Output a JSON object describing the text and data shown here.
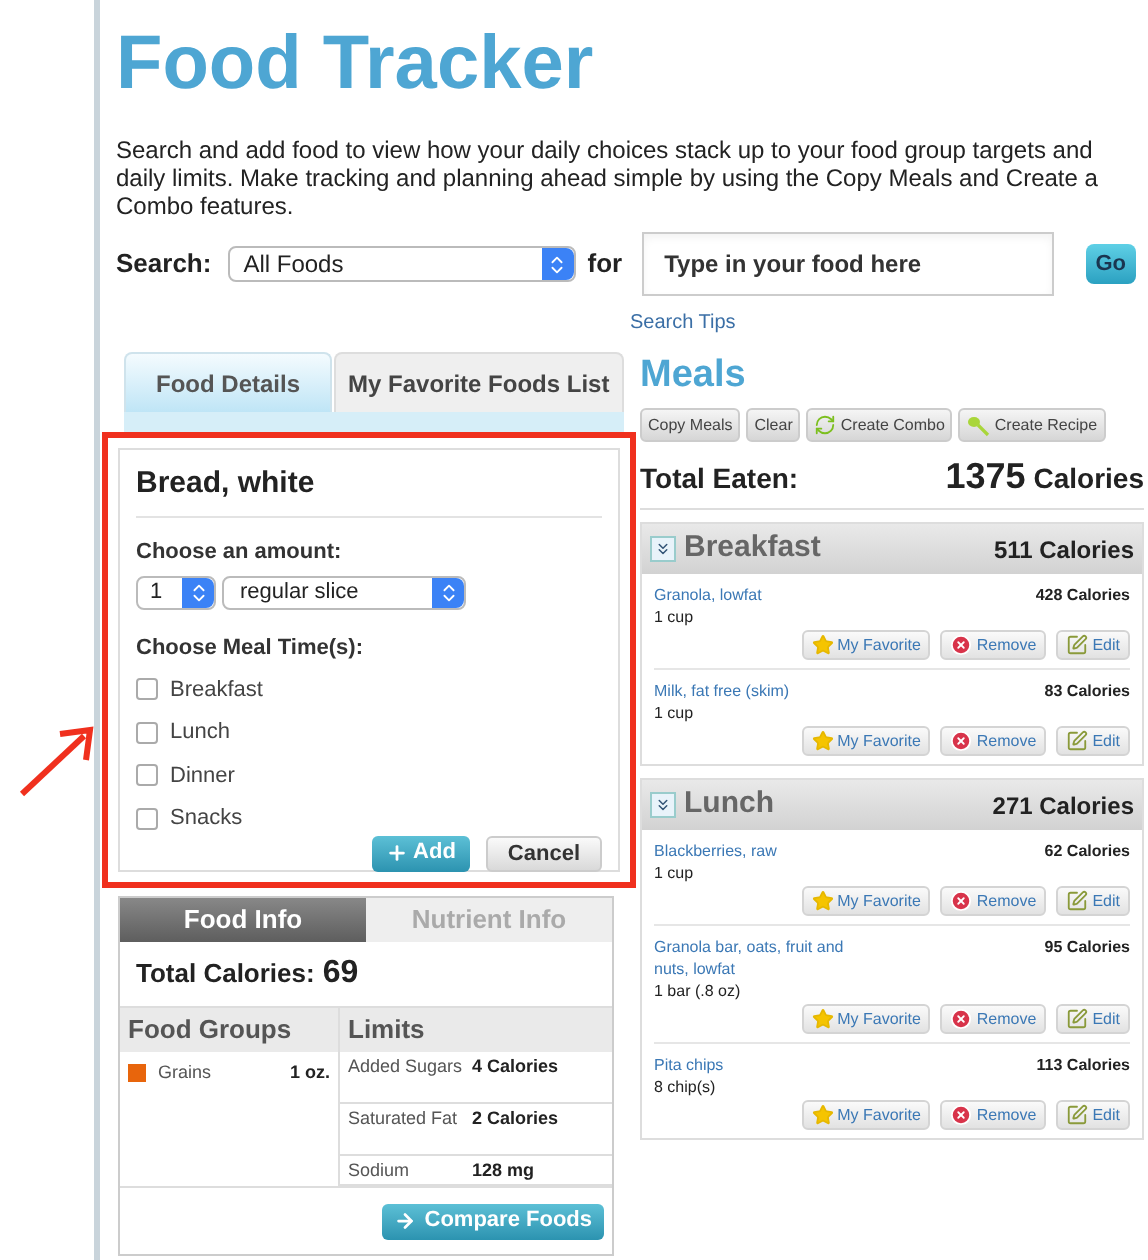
{
  "title": "Food Tracker",
  "intro": "Search and add food to view how your daily choices stack up to your food group targets and daily limits. Make tracking and planning ahead simple by using the Copy Meals and Create a Combo features.",
  "search": {
    "label": "Search:",
    "scope": "All Foods",
    "for_label": "for",
    "placeholder": "Type in your food here",
    "go": "Go",
    "tips": "Search Tips"
  },
  "tabs": [
    {
      "label": "Food Details",
      "selected": true
    },
    {
      "label": "My Favorite Foods List",
      "selected": false
    }
  ],
  "food_details": {
    "name": "Bread, white",
    "amount_label": "Choose an amount:",
    "quantity": "1",
    "unit": "regular slice",
    "meal_label": "Choose Meal Time(s):",
    "meals": [
      {
        "label": "Breakfast",
        "checked": false
      },
      {
        "label": "Lunch",
        "checked": false
      },
      {
        "label": "Dinner",
        "checked": false
      },
      {
        "label": "Snacks",
        "checked": false
      }
    ],
    "add": "Add",
    "cancel": "Cancel"
  },
  "info_tabs": [
    {
      "label": "Food Info",
      "selected": true
    },
    {
      "label": "Nutrient Info",
      "selected": false
    }
  ],
  "total_calories": {
    "label": "Total Calories:",
    "value": "69"
  },
  "food_groups": {
    "heading": "Food Groups",
    "rows": [
      {
        "name": "Grains",
        "amount": "1 oz.",
        "color": "#e8650c"
      }
    ]
  },
  "limits": {
    "heading": "Limits",
    "rows": [
      {
        "name": "Added Sugars",
        "amount": "4 Calories"
      },
      {
        "name": "Saturated Fat",
        "amount": "2 Calories"
      },
      {
        "name": "Sodium",
        "amount": "128 mg"
      }
    ]
  },
  "compare": "Compare Foods",
  "meals": {
    "heading": "Meals",
    "actions": [
      {
        "label": "Copy Meals",
        "kind": "plain"
      },
      {
        "label": "Clear",
        "kind": "plain"
      },
      {
        "label": "Create Combo",
        "kind": "combo"
      },
      {
        "label": "Create Recipe",
        "kind": "recipe"
      }
    ],
    "total_label": "Total Eaten:",
    "total_value": "1375",
    "total_unit": "Calories",
    "sections": [
      {
        "name": "Breakfast",
        "calories": "511 Calories",
        "items": [
          {
            "name": "Granola, lowfat",
            "portion": "1 cup",
            "calories": "428 Calories",
            "buttons": [
              "My Favorite",
              "Remove",
              "Edit"
            ]
          },
          {
            "name": "Milk, fat free (skim)",
            "portion": "1 cup",
            "calories": "83 Calories",
            "buttons": [
              "My Favorite",
              "Remove",
              "Edit"
            ]
          }
        ]
      },
      {
        "name": "Lunch",
        "calories": "271 Calories",
        "items": [
          {
            "name": "Blackberries, raw",
            "portion": "1 cup",
            "calories": "62 Calories",
            "buttons": [
              "My Favorite",
              "Remove",
              "Edit"
            ]
          },
          {
            "name": "Granola bar, oats, fruit and nuts, lowfat",
            "portion": "1 bar (.8 oz)",
            "calories": "95 Calories",
            "buttons": [
              "My Favorite",
              "Remove",
              "Edit"
            ]
          },
          {
            "name": "Pita chips",
            "portion": "8 chip(s)",
            "calories": "113 Calories",
            "buttons": [
              "My Favorite",
              "Remove",
              "Edit"
            ]
          }
        ]
      }
    ]
  }
}
